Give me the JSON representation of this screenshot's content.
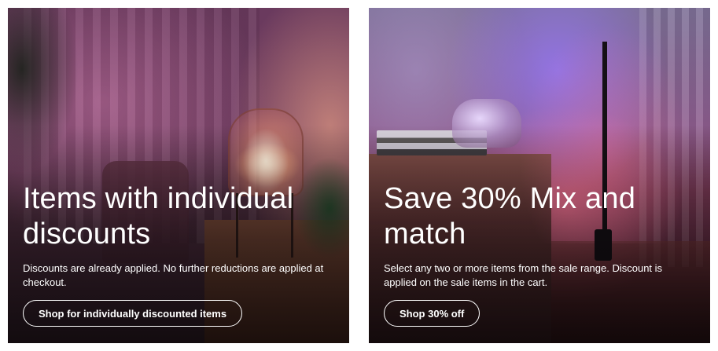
{
  "cards": [
    {
      "heading": "Items with individual discounts",
      "description": "Discounts are already applied. No further reductions are applied at checkout.",
      "button_label": "Shop for individually discounted items"
    },
    {
      "heading": "Save 30% Mix and match",
      "description": "Select any two or more items from the sale range. Discount is applied on the sale items in the cart.",
      "button_label": "Shop 30% off"
    }
  ],
  "colors": {
    "text": "#ffffff",
    "button_border": "#ffffff",
    "page_background": "#ffffff"
  }
}
